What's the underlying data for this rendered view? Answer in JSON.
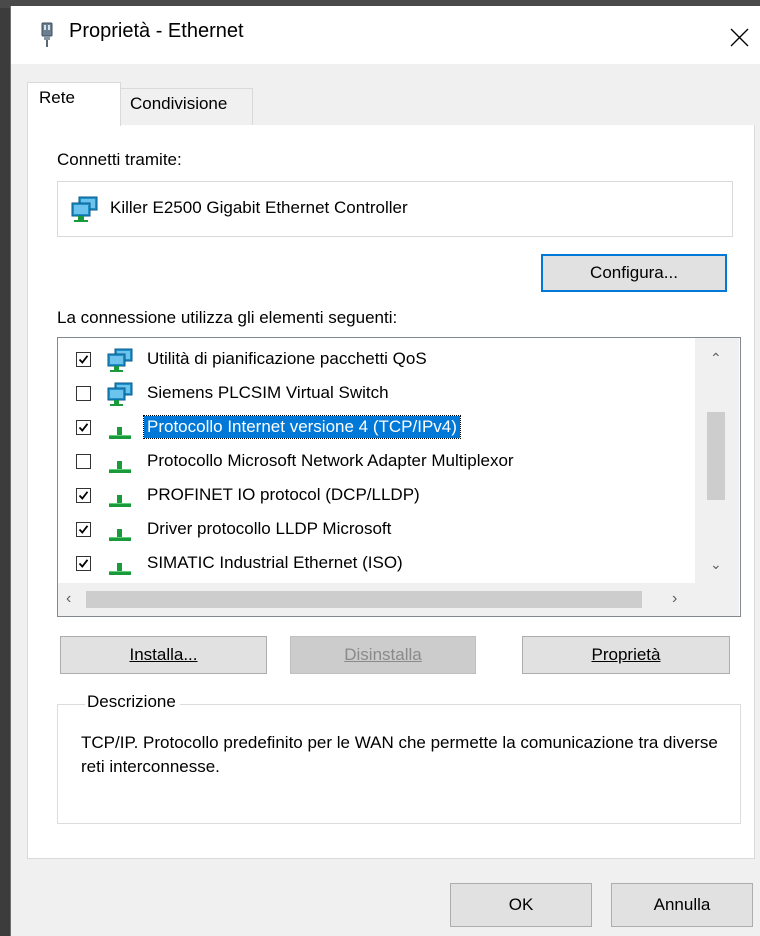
{
  "window": {
    "title": "Proprietà - Ethernet"
  },
  "tabs": [
    {
      "label": "Rete",
      "active": true
    },
    {
      "label": "Condivisione",
      "active": false
    }
  ],
  "connect": {
    "label": "Connetti tramite:",
    "adapter": "Killer E2500 Gigabit Ethernet Controller",
    "configure_button": "Configura..."
  },
  "items": {
    "label": "La connessione utilizza gli elementi seguenti:",
    "list": [
      {
        "label": "Utilità di pianificazione pacchetti QoS",
        "checked": true,
        "icon": "network-adapter-icon",
        "selected": false
      },
      {
        "label": "Siemens PLCSIM Virtual Switch",
        "checked": false,
        "icon": "network-adapter-icon",
        "selected": false
      },
      {
        "label": "Protocollo Internet versione 4 (TCP/IPv4)",
        "checked": true,
        "icon": "protocol-icon",
        "selected": true
      },
      {
        "label": "Protocollo Microsoft Network Adapter Multiplexor",
        "checked": false,
        "icon": "protocol-icon",
        "selected": false
      },
      {
        "label": "PROFINET IO protocol (DCP/LLDP)",
        "checked": true,
        "icon": "protocol-icon",
        "selected": false
      },
      {
        "label": "Driver protocollo LLDP Microsoft",
        "checked": true,
        "icon": "protocol-icon",
        "selected": false
      },
      {
        "label": "SIMATIC Industrial Ethernet (ISO)",
        "checked": true,
        "icon": "protocol-icon",
        "selected": false
      }
    ]
  },
  "buttons": {
    "install": "Installa...",
    "uninstall": "Disinstalla",
    "properties": "Proprietà",
    "ok": "OK",
    "cancel": "Annulla"
  },
  "description": {
    "legend": "Descrizione",
    "text": "TCP/IP. Protocollo predefinito per le WAN che permette la comunicazione tra diverse reti interconnesse."
  },
  "colors": {
    "selection": "#0078d7",
    "focus": "#0078d7",
    "dialog_bg": "#f0f0f0"
  }
}
